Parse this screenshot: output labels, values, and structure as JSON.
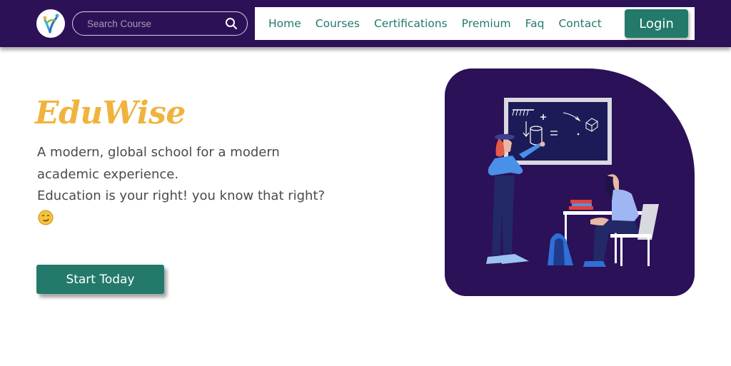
{
  "nav": {
    "search": {
      "placeholder": "Search Course",
      "value": ""
    },
    "links": [
      "Home",
      "Courses",
      "Certifications",
      "Premium",
      "Faq",
      "Contact"
    ],
    "login_label": "Login"
  },
  "hero": {
    "brand": "EduWise",
    "tagline_lines": [
      "A modern, global school for a modern",
      "academic experience.",
      "Education is your right! you know that right?"
    ],
    "emoji_icon": "smirk-emoji-icon",
    "cta_label": "Start Today"
  },
  "colors": {
    "nav_bg": "#2d1157",
    "accent": "#237a6a",
    "brand": "#f0b33d",
    "illustration_bg": "#2a1158"
  }
}
